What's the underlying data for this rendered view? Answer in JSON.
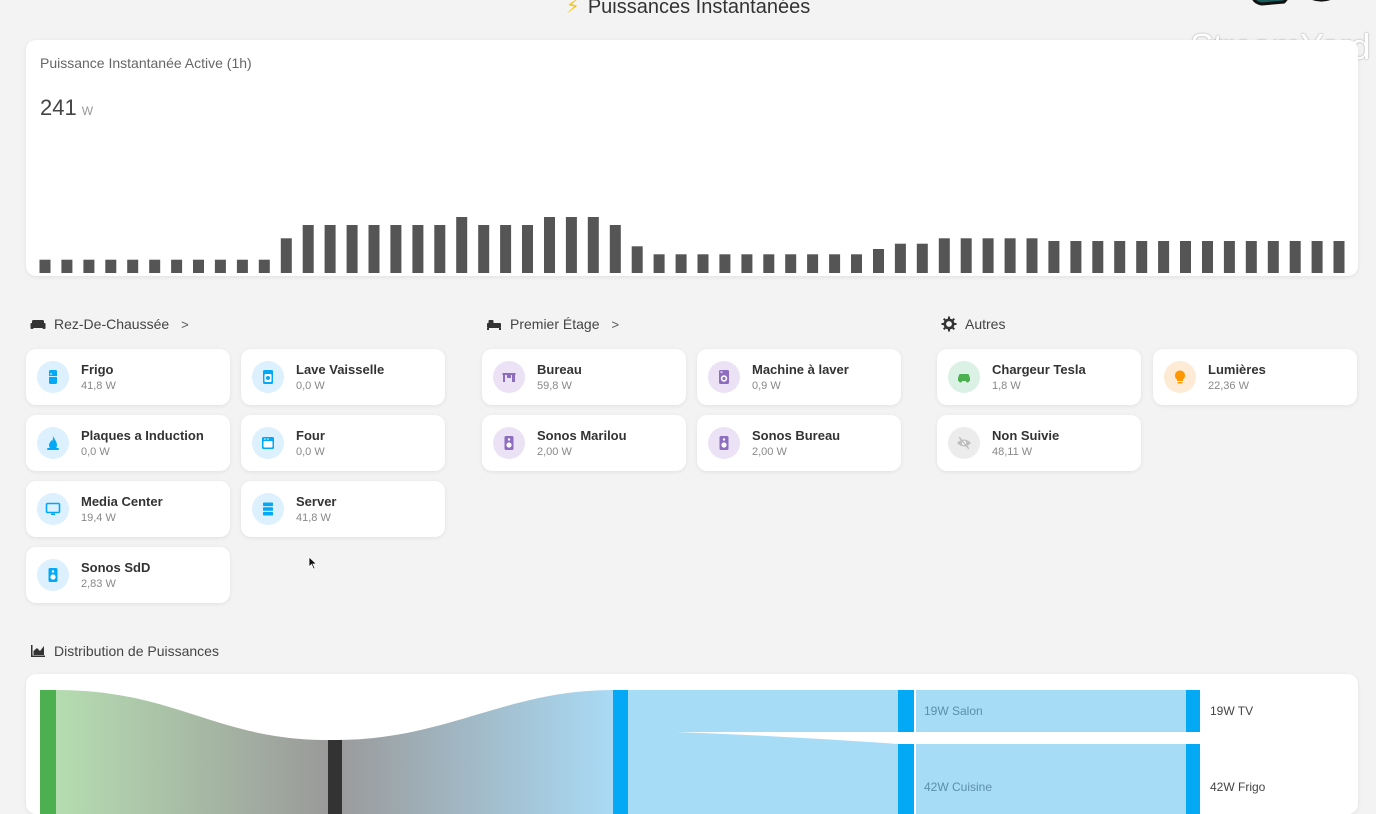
{
  "page": {
    "title": "Puissances Instantanées",
    "watermark": "StreamYard"
  },
  "colors": {
    "bar": "#555555",
    "blue_accent": "#03a9f4",
    "purple_accent": "#8e6cc0",
    "green_accent": "#4caf50",
    "orange_accent": "#ff9800",
    "grey_accent": "#bdbdbd",
    "sankey_light_blue": "#a7dcf7",
    "sankey_source_green": "#4caf50"
  },
  "power_chart": {
    "title": "Puissance Instantanée Active (1h)",
    "value": "241",
    "unit": "W"
  },
  "chart_data": {
    "type": "bar",
    "values": [
      5,
      5,
      5,
      5,
      5,
      5,
      5,
      5,
      5,
      5,
      5,
      13,
      18,
      18,
      18,
      18,
      18,
      18,
      18,
      21,
      18,
      18,
      18,
      21,
      21,
      21,
      18,
      10,
      7,
      7,
      7,
      7,
      7,
      7,
      7,
      7,
      7,
      7,
      9,
      11,
      11,
      13,
      13,
      13,
      13,
      13,
      12,
      12,
      12,
      12,
      12,
      12,
      12,
      12,
      12,
      12,
      12,
      12,
      12,
      12
    ],
    "ylim": [
      0,
      30
    ],
    "grid": false
  },
  "sections": [
    {
      "title": "Rez-De-Chaussée",
      "icon": "sofa-icon",
      "has_chevron": true,
      "devices": [
        {
          "name": "Frigo",
          "value": "41,8 W",
          "icon": "fridge-icon",
          "color": "blue"
        },
        {
          "name": "Lave Vaisselle",
          "value": "0,0 W",
          "icon": "dishwasher-icon",
          "color": "blue"
        },
        {
          "name": "Plaques a Induction",
          "value": "0,0 W",
          "icon": "flame-icon",
          "color": "blue"
        },
        {
          "name": "Four",
          "value": "0,0 W",
          "icon": "oven-icon",
          "color": "blue"
        },
        {
          "name": "Media Center",
          "value": "19,4 W",
          "icon": "monitor-icon",
          "color": "blue"
        },
        {
          "name": "Server",
          "value": "41,8 W",
          "icon": "server-icon",
          "color": "blue"
        },
        {
          "name": "Sonos SdD",
          "value": "2,83 W",
          "icon": "speaker-icon",
          "color": "blue"
        }
      ]
    },
    {
      "title": "Premier Étage",
      "icon": "bed-icon",
      "has_chevron": true,
      "devices": [
        {
          "name": "Bureau",
          "value": "59,8 W",
          "icon": "desk-icon",
          "color": "purple"
        },
        {
          "name": "Machine à laver",
          "value": "0,9 W",
          "icon": "washing-machine-icon",
          "color": "purple"
        },
        {
          "name": "Sonos Marilou",
          "value": "2,00 W",
          "icon": "speaker-icon",
          "color": "purple"
        },
        {
          "name": "Sonos Bureau",
          "value": "2,00 W",
          "icon": "speaker-icon",
          "color": "purple"
        }
      ]
    },
    {
      "title": "Autres",
      "icon": "gear-icon",
      "has_chevron": false,
      "devices": [
        {
          "name": "Chargeur Tesla",
          "value": "1,8 W",
          "icon": "car-charger-icon",
          "color": "green"
        },
        {
          "name": "Lumières",
          "value": "22,36 W",
          "icon": "lightbulb-icon",
          "color": "orange"
        },
        {
          "name": "Non Suivie",
          "value": "48,11 W",
          "icon": "eye-off-icon",
          "color": "grey"
        }
      ]
    }
  ],
  "distribution": {
    "title": "Distribution de Puissances",
    "icon": "chart-area-icon",
    "nodes": {
      "salon": "19W Salon",
      "cuisine": "42W Cuisine",
      "tv": "19W TV",
      "frigo": "42W Frigo"
    }
  }
}
